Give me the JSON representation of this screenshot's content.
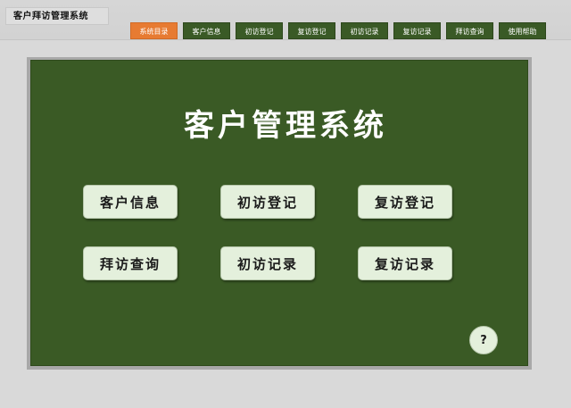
{
  "app": {
    "title": "客户拜访管理系统"
  },
  "nav": {
    "tabs": [
      {
        "label": "系统目录",
        "active": true
      },
      {
        "label": "客户信息",
        "active": false
      },
      {
        "label": "初访登记",
        "active": false
      },
      {
        "label": "复访登记",
        "active": false
      },
      {
        "label": "初访记录",
        "active": false
      },
      {
        "label": "复访记录",
        "active": false
      },
      {
        "label": "拜访查询",
        "active": false
      },
      {
        "label": "使用帮助",
        "active": false
      }
    ]
  },
  "main": {
    "title": "客户管理系统",
    "buttons": [
      {
        "label": "客户信息"
      },
      {
        "label": "初访登记"
      },
      {
        "label": "复访登记"
      },
      {
        "label": "拜访查询"
      },
      {
        "label": "初访记录"
      },
      {
        "label": "复访记录"
      }
    ],
    "help_label": "?"
  },
  "colors": {
    "panel": "#3a5a25",
    "nav_tab": "#3a5a26",
    "nav_active": "#e77b32",
    "button_face": "#e4f0dc",
    "background": "#d9d9d9"
  }
}
